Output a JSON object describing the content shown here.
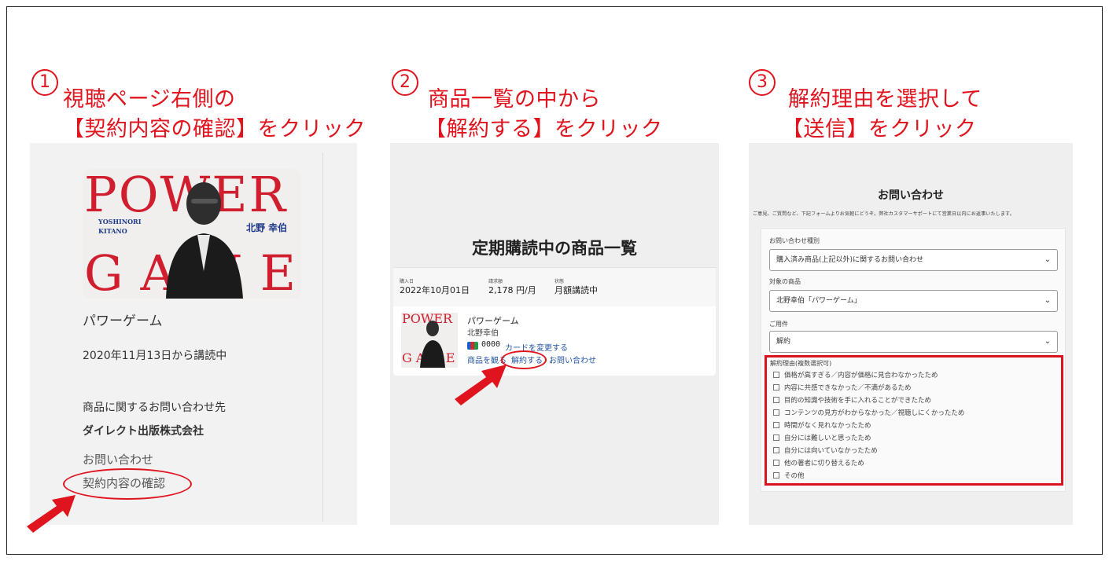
{
  "colors": {
    "accent_red": "#e0141e",
    "panel_gray": "#efefef",
    "link_blue": "#2456a6"
  },
  "steps": [
    {
      "num": "1",
      "line1": "視聴ページ右側の",
      "line2": "【契約内容の確認】をクリック"
    },
    {
      "num": "2",
      "line1": "商品一覧の中から",
      "line2": "【解約する】をクリック"
    },
    {
      "num": "3",
      "line1": "解約理由を選択して",
      "line2": "【送信】をクリック"
    }
  ],
  "cover": {
    "top_word": "POWER",
    "bottom_word": "GAME",
    "author_en_1": "YOSHINORI",
    "author_en_2": "KITANO",
    "author_jp": "北野 幸伯"
  },
  "panel1": {
    "product_name": "パワーゲーム",
    "subscribed_since": "2020年11月13日から講読中",
    "contact_heading": "商品に関するお問い合わせ先",
    "company": "ダイレクト出版株式会社",
    "contact_link": "お問い合わせ",
    "contract_link": "契約内容の確認"
  },
  "panel2": {
    "title": "定期購読中の商品一覧",
    "purchase_date_label": "購入日",
    "purchase_date": "2022年10月01日",
    "billing_label": "請求額",
    "billing": "2,178 円/月",
    "status_label": "状態",
    "status": "月額講読中",
    "product_name": "パワーゲーム",
    "author": "北野幸伯",
    "card_last4": "0000",
    "change_card": "カードを変更する",
    "watch_link": "商品を観る",
    "cancel_link": "解約する",
    "contact_link": "お問い合わせ"
  },
  "panel3": {
    "title": "お問い合わせ",
    "intro": "ご意見、ご質問など、下記フォームよりお気軽にどうぞ。弊社カスタマーサポートにて営業日以内にお返事いたします。",
    "type_label": "お問い合わせ種別",
    "type_value": "購入済み商品(上記以外)に関するお問い合わせ",
    "product_label": "対象の商品",
    "product_value": "北野幸伯「パワーゲーム」",
    "subject_label": "ご用件",
    "subject_value": "解約",
    "reasons_label": "解約理由(複数選択可)",
    "reasons": [
      "価格が高すぎる／内容が価格に見合わなかったため",
      "内容に共感できなかった／不満があるため",
      "目的の知識や技術を手に入れることができたため",
      "コンテンツの見方がわからなかった／視聴しにくかったため",
      "時間がなく見れなかったため",
      "自分には難しいと思ったため",
      "自分には向いていなかったため",
      "他の著者に切り替えるため",
      "その他"
    ]
  }
}
